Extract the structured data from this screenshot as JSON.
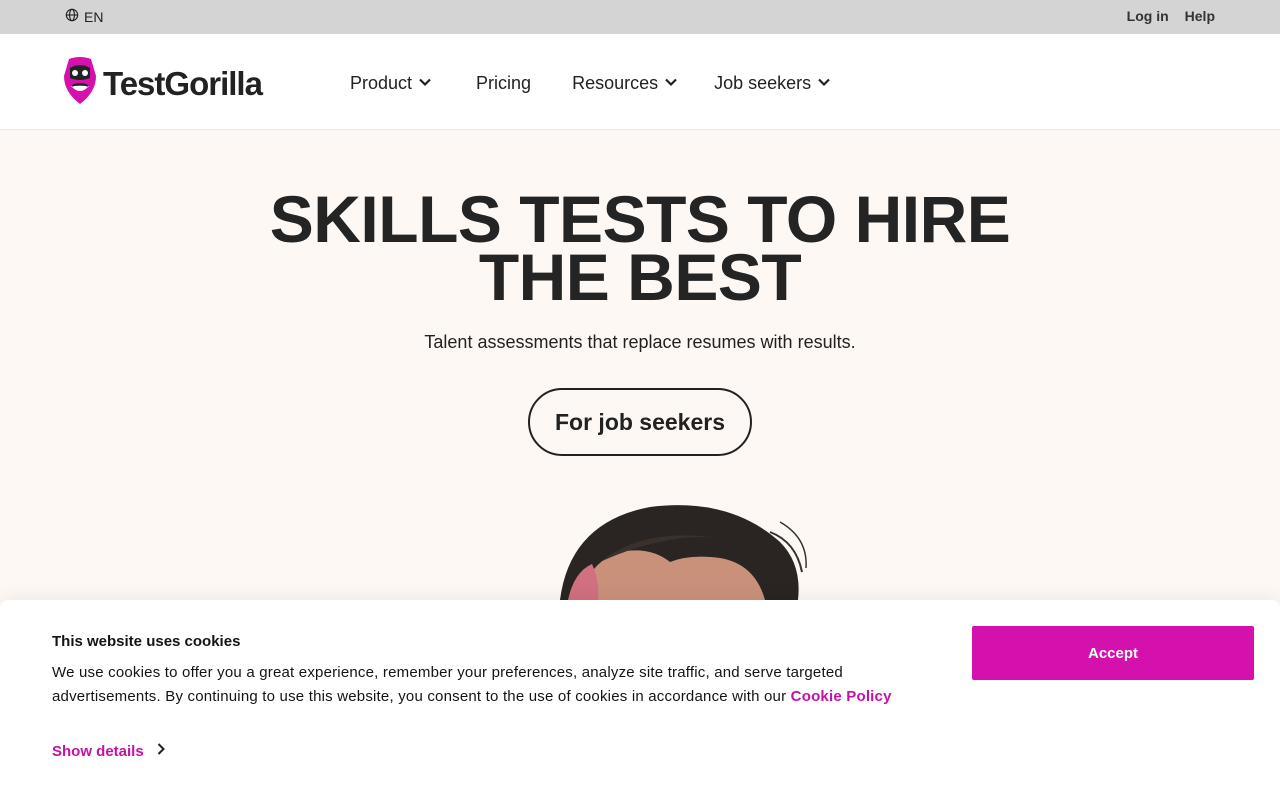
{
  "topbar": {
    "language": "EN",
    "login": "Log in",
    "help": "Help"
  },
  "brand": {
    "name": "TestGorilla",
    "accent_color": "#d411ad"
  },
  "nav": {
    "items": [
      {
        "label": "Product",
        "has_dropdown": true
      },
      {
        "label": "Pricing",
        "has_dropdown": false
      },
      {
        "label": "Resources",
        "has_dropdown": true
      },
      {
        "label": "Job seekers",
        "has_dropdown": true
      }
    ]
  },
  "hero": {
    "headline_line1": "SKILLS TESTS TO HIRE",
    "headline_line2": "THE BEST",
    "subheadline": "Talent assessments that replace resumes with results.",
    "cta_label": "For job seekers"
  },
  "cookie_banner": {
    "title": "This website uses cookies",
    "text": "We use cookies to offer you a great experience, remember your preferences, analyze site traffic, and serve targeted advertisements. By continuing to use this website, you consent to the use of cookies in accordance with our",
    "policy_link": "Cookie Policy",
    "show_details": "Show details",
    "accept_label": "Accept"
  },
  "icons": {
    "language": "globe-icon",
    "dropdown": "chevron-down-icon",
    "details": "chevron-right-icon"
  }
}
